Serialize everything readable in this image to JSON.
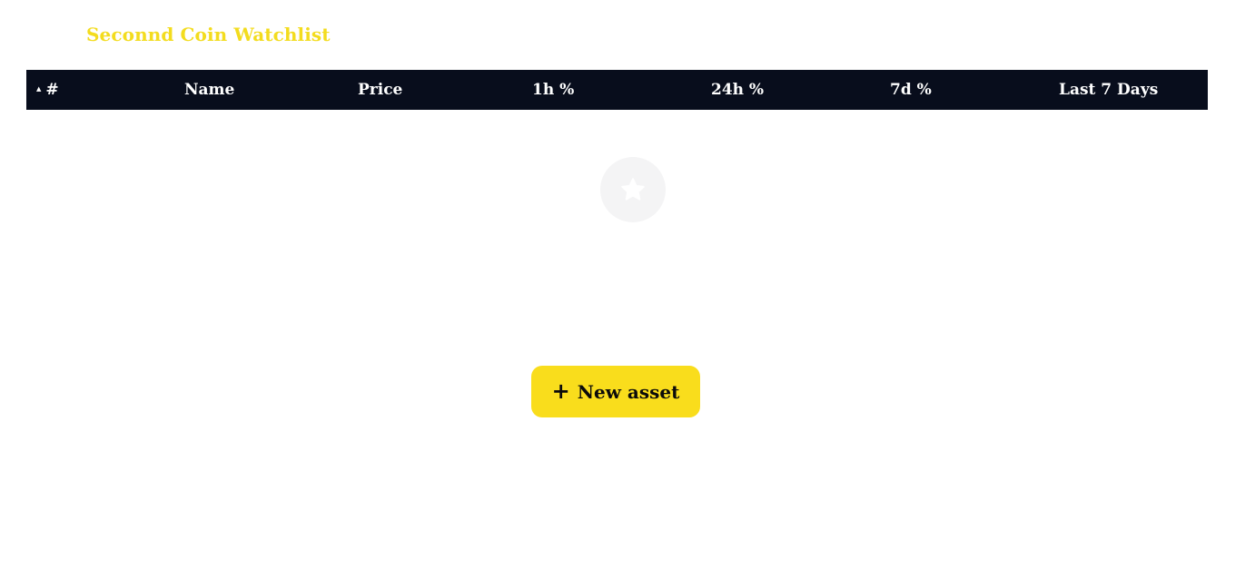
{
  "watchlist": {
    "title": "Seconnd Coin Watchlist"
  },
  "table": {
    "sort_indicator_icon": "sort-ascending-icon",
    "columns": [
      "#",
      "Name",
      "Price",
      "1h %",
      "24h %",
      "7d %",
      "Last 7 Days"
    ],
    "rows": []
  },
  "empty_state": {
    "icon": "star-icon"
  },
  "actions": {
    "new_asset_icon": "plus-icon",
    "new_asset_label": "New asset"
  },
  "colors": {
    "accent_yellow": "#f9dd1c",
    "title_yellow": "#f3dc1e",
    "header_background": "#080d1c",
    "empty_icon_background": "#f4f4f5"
  }
}
